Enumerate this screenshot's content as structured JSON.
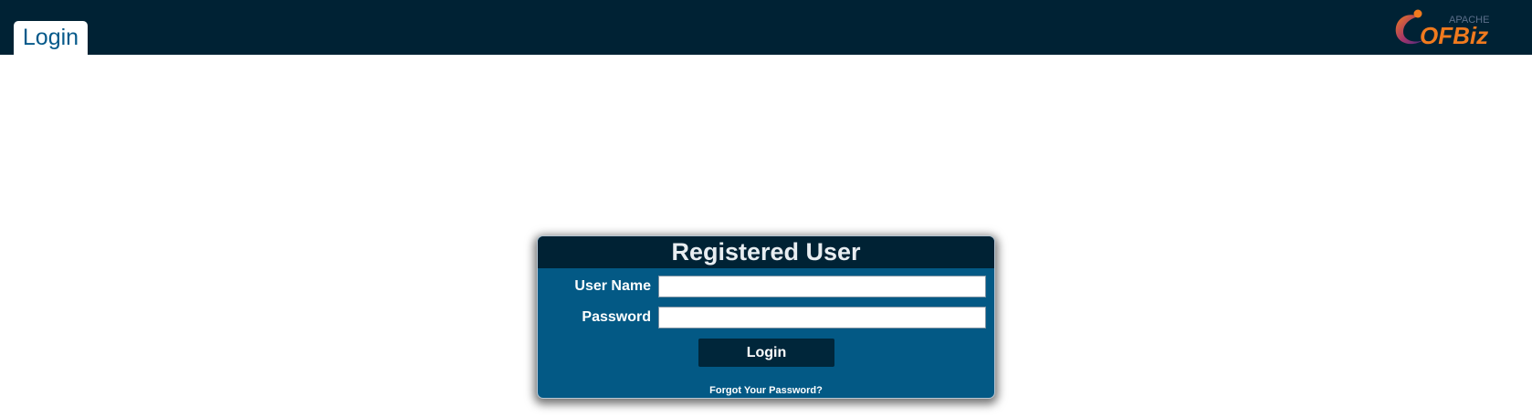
{
  "header": {
    "tab_label": "Login",
    "logo": {
      "name": "apache-ofbiz-logo",
      "small_text": "APACHE",
      "main_text": "OFBiz",
      "colors": {
        "orange": "#f07a1e",
        "purple": "#5d2a7e",
        "small_text": "#5b6f8a"
      }
    }
  },
  "login_panel": {
    "title": "Registered User",
    "username_label": "User Name",
    "username_value": "",
    "password_label": "Password",
    "password_value": "",
    "submit_label": "Login",
    "forgot_password_link": "Forgot Your Password?"
  },
  "colors": {
    "header_bg": "#002234",
    "panel_bg": "#035985",
    "button_bg": "#00263a",
    "tab_text": "#04598a"
  }
}
